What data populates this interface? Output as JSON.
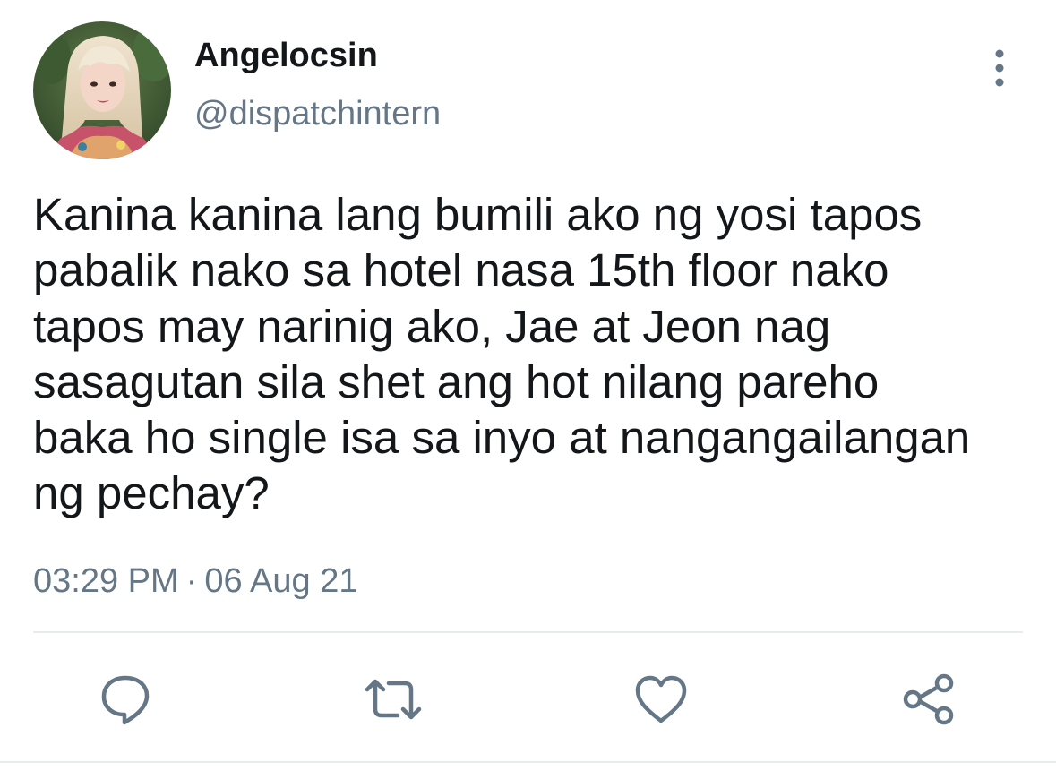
{
  "tweet": {
    "author": {
      "display_name": "Angelocsin",
      "handle": "@dispatchintern"
    },
    "text": "Kanina kanina lang bumili ako ng yosi tapos\npabalik nako sa hotel nasa 15th floor nako\ntapos may narinig ako, Jae at Jeon nag\nsasagutan sila shet ang hot nilang pareho\nbaka ho single isa sa inyo at nangangailangan\nng pechay?",
    "time": "03:29 PM",
    "separator": "·",
    "date": "06 Aug 21"
  },
  "actions": {
    "reply_icon": "reply-bubble-icon",
    "retweet_icon": "retweet-icon",
    "like_icon": "heart-icon",
    "share_icon": "share-icon"
  },
  "colors": {
    "text": "#14171a",
    "secondary": "#657786",
    "divider": "#e6ecf0"
  }
}
